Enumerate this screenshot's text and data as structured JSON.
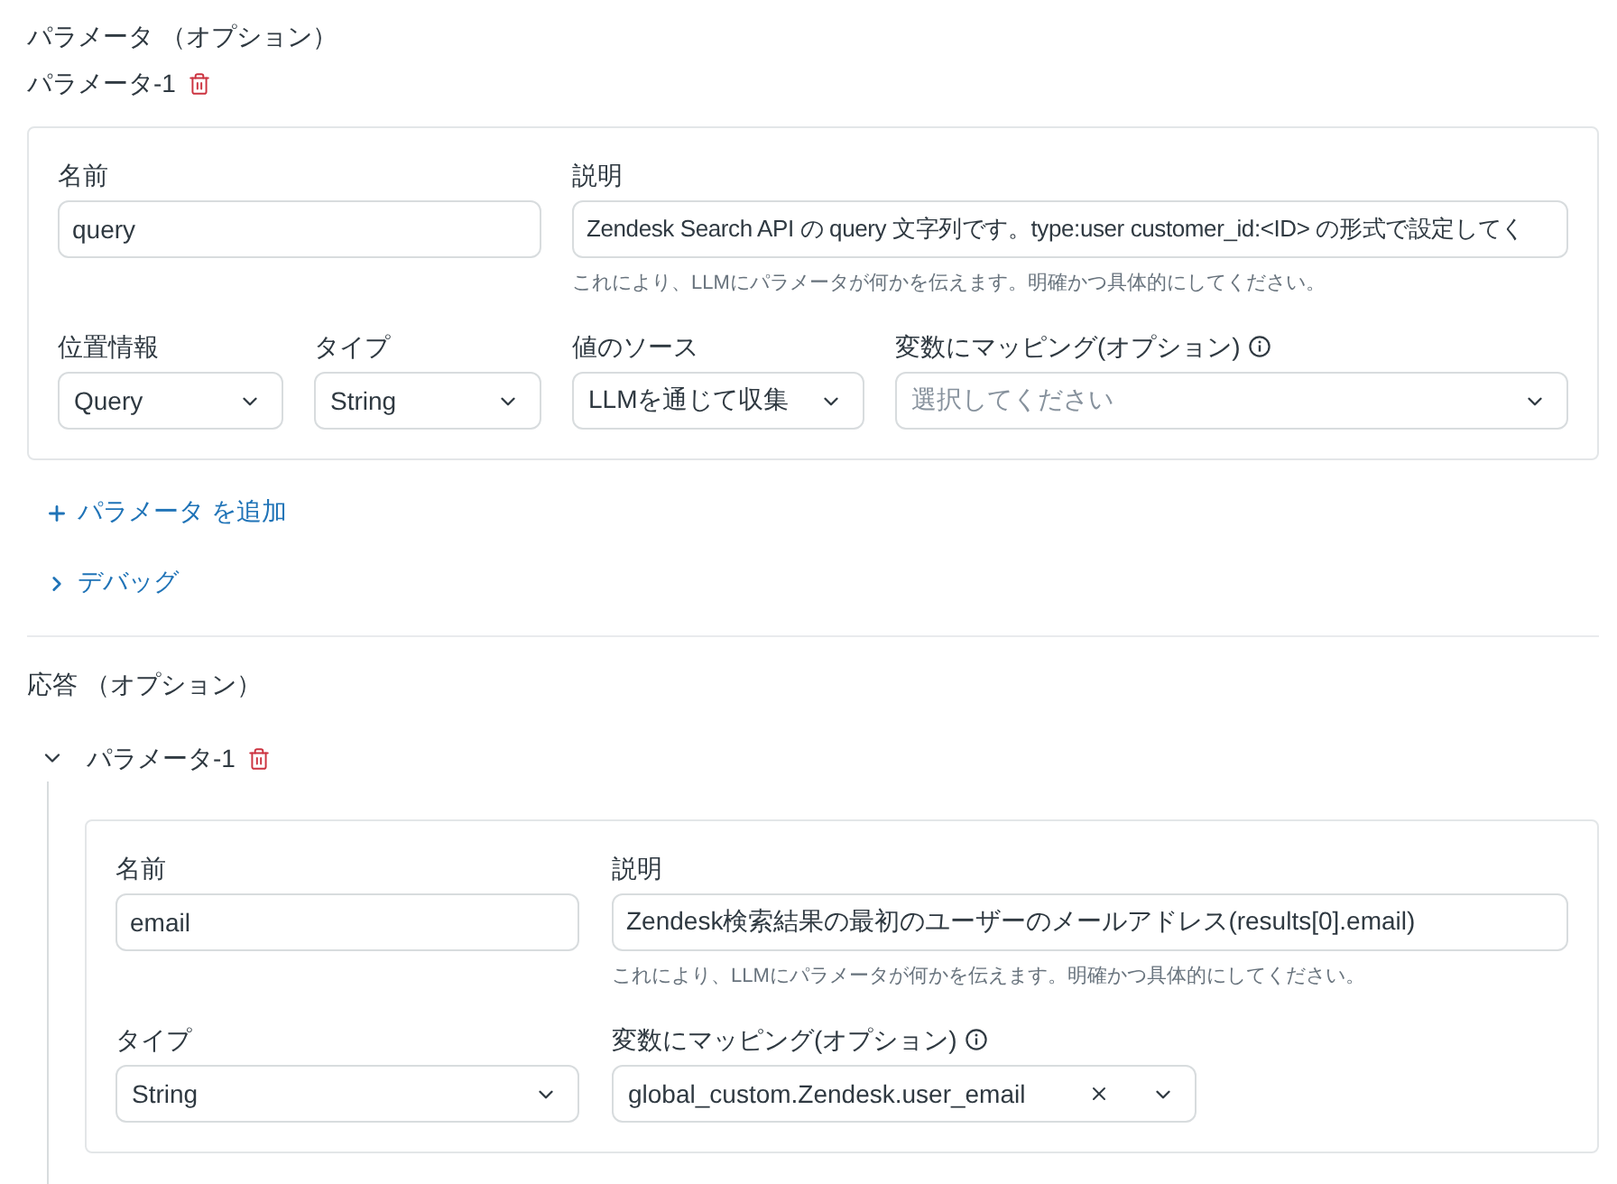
{
  "request": {
    "heading": "パラメータ （オプション）",
    "parameters": [
      {
        "title": "パラメータ-1",
        "name": {
          "label": "名前",
          "value": "query"
        },
        "description": {
          "label": "説明",
          "value": "Zendesk Search API の query 文字列です。type:user customer_id:<ID> の形式で設定してく",
          "hint": "これにより、LLMにパラメータが何かを伝えます。明確かつ具体的にしてください。"
        },
        "location": {
          "label": "位置情報",
          "value": "Query"
        },
        "type": {
          "label": "タイプ",
          "value": "String"
        },
        "source": {
          "label": "値のソース",
          "value": "LLMを通じて収集"
        },
        "mapping": {
          "label": "変数にマッピング(オプション)",
          "placeholder": "選択してください"
        }
      }
    ]
  },
  "add_parameter": {
    "label": "パラメータ を追加"
  },
  "debug": {
    "label": "デバッグ",
    "expanded": false
  },
  "response": {
    "heading": "応答 （オプション）",
    "parameters": [
      {
        "title": "パラメータ-1",
        "expanded": true,
        "name": {
          "label": "名前",
          "value": "email"
        },
        "description": {
          "label": "説明",
          "value": "Zendesk検索結果の最初のユーザーのメールアドレス(results[0].email)",
          "hint": "これにより、LLMにパラメータが何かを伝えます。明確かつ具体的にしてください。"
        },
        "type": {
          "label": "タイプ",
          "value": "String"
        },
        "mapping": {
          "label": "変数にマッピング(オプション)",
          "value": "global_custom.Zendesk.user_email"
        }
      }
    ]
  }
}
